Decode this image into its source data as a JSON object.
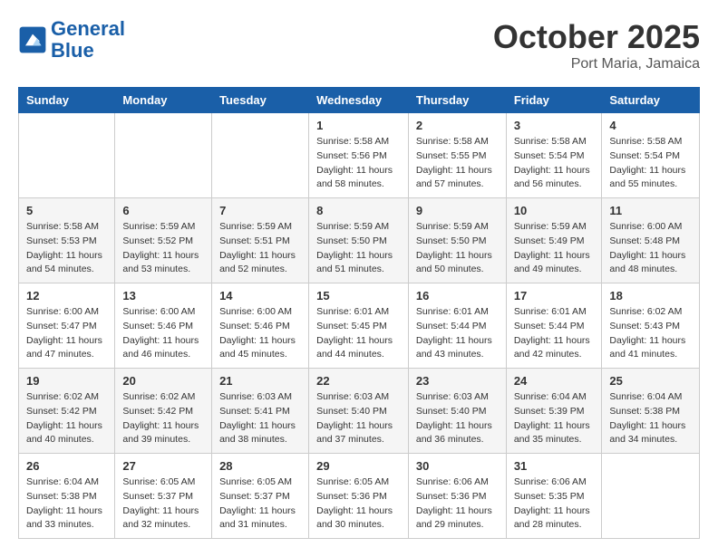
{
  "logo": {
    "line1": "General",
    "line2": "Blue"
  },
  "title": "October 2025",
  "subtitle": "Port Maria, Jamaica",
  "days_of_week": [
    "Sunday",
    "Monday",
    "Tuesday",
    "Wednesday",
    "Thursday",
    "Friday",
    "Saturday"
  ],
  "weeks": [
    [
      {
        "day": "",
        "info": ""
      },
      {
        "day": "",
        "info": ""
      },
      {
        "day": "",
        "info": ""
      },
      {
        "day": "1",
        "info": "Sunrise: 5:58 AM\nSunset: 5:56 PM\nDaylight: 11 hours\nand 58 minutes."
      },
      {
        "day": "2",
        "info": "Sunrise: 5:58 AM\nSunset: 5:55 PM\nDaylight: 11 hours\nand 57 minutes."
      },
      {
        "day": "3",
        "info": "Sunrise: 5:58 AM\nSunset: 5:54 PM\nDaylight: 11 hours\nand 56 minutes."
      },
      {
        "day": "4",
        "info": "Sunrise: 5:58 AM\nSunset: 5:54 PM\nDaylight: 11 hours\nand 55 minutes."
      }
    ],
    [
      {
        "day": "5",
        "info": "Sunrise: 5:58 AM\nSunset: 5:53 PM\nDaylight: 11 hours\nand 54 minutes."
      },
      {
        "day": "6",
        "info": "Sunrise: 5:59 AM\nSunset: 5:52 PM\nDaylight: 11 hours\nand 53 minutes."
      },
      {
        "day": "7",
        "info": "Sunrise: 5:59 AM\nSunset: 5:51 PM\nDaylight: 11 hours\nand 52 minutes."
      },
      {
        "day": "8",
        "info": "Sunrise: 5:59 AM\nSunset: 5:50 PM\nDaylight: 11 hours\nand 51 minutes."
      },
      {
        "day": "9",
        "info": "Sunrise: 5:59 AM\nSunset: 5:50 PM\nDaylight: 11 hours\nand 50 minutes."
      },
      {
        "day": "10",
        "info": "Sunrise: 5:59 AM\nSunset: 5:49 PM\nDaylight: 11 hours\nand 49 minutes."
      },
      {
        "day": "11",
        "info": "Sunrise: 6:00 AM\nSunset: 5:48 PM\nDaylight: 11 hours\nand 48 minutes."
      }
    ],
    [
      {
        "day": "12",
        "info": "Sunrise: 6:00 AM\nSunset: 5:47 PM\nDaylight: 11 hours\nand 47 minutes."
      },
      {
        "day": "13",
        "info": "Sunrise: 6:00 AM\nSunset: 5:46 PM\nDaylight: 11 hours\nand 46 minutes."
      },
      {
        "day": "14",
        "info": "Sunrise: 6:00 AM\nSunset: 5:46 PM\nDaylight: 11 hours\nand 45 minutes."
      },
      {
        "day": "15",
        "info": "Sunrise: 6:01 AM\nSunset: 5:45 PM\nDaylight: 11 hours\nand 44 minutes."
      },
      {
        "day": "16",
        "info": "Sunrise: 6:01 AM\nSunset: 5:44 PM\nDaylight: 11 hours\nand 43 minutes."
      },
      {
        "day": "17",
        "info": "Sunrise: 6:01 AM\nSunset: 5:44 PM\nDaylight: 11 hours\nand 42 minutes."
      },
      {
        "day": "18",
        "info": "Sunrise: 6:02 AM\nSunset: 5:43 PM\nDaylight: 11 hours\nand 41 minutes."
      }
    ],
    [
      {
        "day": "19",
        "info": "Sunrise: 6:02 AM\nSunset: 5:42 PM\nDaylight: 11 hours\nand 40 minutes."
      },
      {
        "day": "20",
        "info": "Sunrise: 6:02 AM\nSunset: 5:42 PM\nDaylight: 11 hours\nand 39 minutes."
      },
      {
        "day": "21",
        "info": "Sunrise: 6:03 AM\nSunset: 5:41 PM\nDaylight: 11 hours\nand 38 minutes."
      },
      {
        "day": "22",
        "info": "Sunrise: 6:03 AM\nSunset: 5:40 PM\nDaylight: 11 hours\nand 37 minutes."
      },
      {
        "day": "23",
        "info": "Sunrise: 6:03 AM\nSunset: 5:40 PM\nDaylight: 11 hours\nand 36 minutes."
      },
      {
        "day": "24",
        "info": "Sunrise: 6:04 AM\nSunset: 5:39 PM\nDaylight: 11 hours\nand 35 minutes."
      },
      {
        "day": "25",
        "info": "Sunrise: 6:04 AM\nSunset: 5:38 PM\nDaylight: 11 hours\nand 34 minutes."
      }
    ],
    [
      {
        "day": "26",
        "info": "Sunrise: 6:04 AM\nSunset: 5:38 PM\nDaylight: 11 hours\nand 33 minutes."
      },
      {
        "day": "27",
        "info": "Sunrise: 6:05 AM\nSunset: 5:37 PM\nDaylight: 11 hours\nand 32 minutes."
      },
      {
        "day": "28",
        "info": "Sunrise: 6:05 AM\nSunset: 5:37 PM\nDaylight: 11 hours\nand 31 minutes."
      },
      {
        "day": "29",
        "info": "Sunrise: 6:05 AM\nSunset: 5:36 PM\nDaylight: 11 hours\nand 30 minutes."
      },
      {
        "day": "30",
        "info": "Sunrise: 6:06 AM\nSunset: 5:36 PM\nDaylight: 11 hours\nand 29 minutes."
      },
      {
        "day": "31",
        "info": "Sunrise: 6:06 AM\nSunset: 5:35 PM\nDaylight: 11 hours\nand 28 minutes."
      },
      {
        "day": "",
        "info": ""
      }
    ]
  ]
}
